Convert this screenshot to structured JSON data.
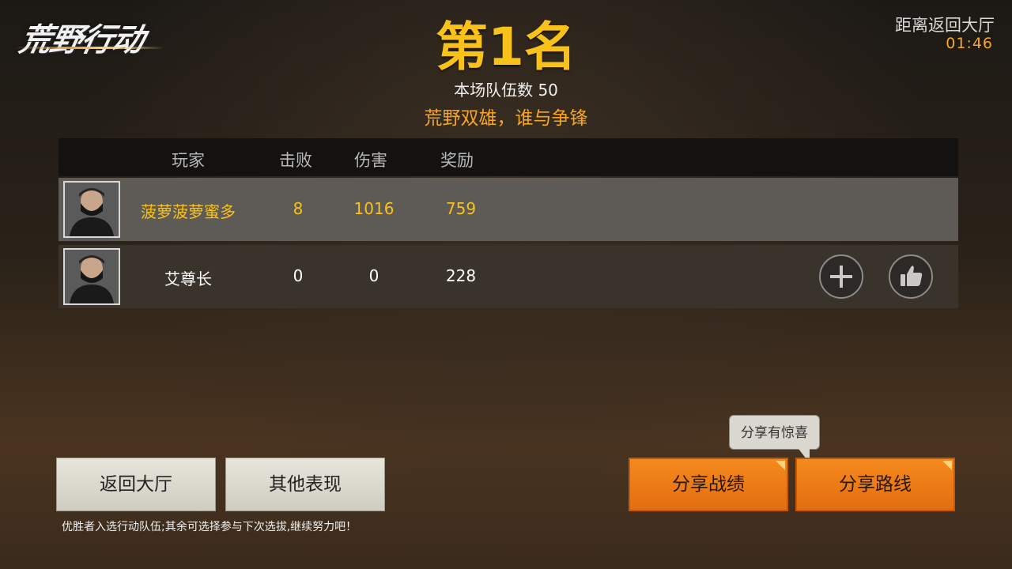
{
  "logo": {
    "text": "荒野行动"
  },
  "timer": {
    "label": "距离返回大厅",
    "value": "01:46"
  },
  "header": {
    "rank": "第1名",
    "teams": "本场队伍数 50",
    "slogan": "荒野双雄，谁与争锋"
  },
  "table": {
    "columns": [
      "玩家",
      "击败",
      "伤害",
      "奖励"
    ],
    "rows": [
      {
        "name": "菠萝菠萝蜜多",
        "kills": "8",
        "damage": "1016",
        "reward": "759"
      },
      {
        "name": "艾尊长",
        "kills": "0",
        "damage": "0",
        "reward": "228"
      }
    ]
  },
  "buttons": {
    "back_lobby": "返回大厅",
    "other_stats": "其他表现",
    "share_record": "分享战绩",
    "share_route": "分享路线"
  },
  "tooltip": {
    "text": "分享有惊喜"
  },
  "hint": "优胜者入选行动队伍;其余可选择参与下次选拔,继续努力吧！",
  "icons": {
    "add_friend": "plus-icon",
    "like": "thumbs-up-icon"
  },
  "colors": {
    "accent_gold": "#f8c21b",
    "accent_orange": "#f7a623",
    "button_orange": "#f58a1d"
  }
}
